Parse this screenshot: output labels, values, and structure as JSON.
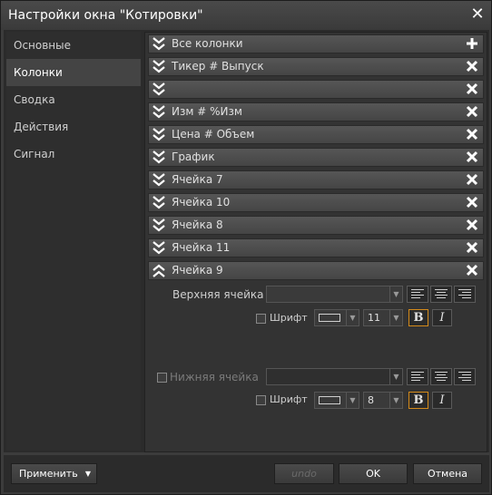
{
  "window": {
    "title": "Настройки окна \"Котировки\""
  },
  "sidebar": {
    "items": [
      {
        "label": "Основные"
      },
      {
        "label": "Колонки"
      },
      {
        "label": "Сводка"
      },
      {
        "label": "Действия"
      },
      {
        "label": "Сигнал"
      }
    ],
    "active_index": 1
  },
  "columns": {
    "rows": [
      {
        "label": "Все колонки",
        "action_icon": "plus-icon"
      },
      {
        "label": "Тикер # Выпуск",
        "action_icon": "close-icon"
      },
      {
        "label": "",
        "action_icon": "close-icon"
      },
      {
        "label": "Изм # %Изм",
        "action_icon": "close-icon"
      },
      {
        "label": "Цена # Объем",
        "action_icon": "close-icon"
      },
      {
        "label": "График",
        "action_icon": "close-icon"
      },
      {
        "label": "Ячейка 7",
        "action_icon": "close-icon"
      },
      {
        "label": "Ячейка 10",
        "action_icon": "close-icon"
      },
      {
        "label": "Ячейка 8",
        "action_icon": "close-icon"
      },
      {
        "label": "Ячейка 11",
        "action_icon": "close-icon"
      },
      {
        "label": "Ячейка 9",
        "action_icon": "close-icon",
        "expanded": true
      }
    ],
    "editor": {
      "top_cell": {
        "label": "Верхняя ячейка",
        "value": "",
        "font_checkbox_label": "Шрифт",
        "font_size": "11",
        "bold_label": "B",
        "italic_label": "I"
      },
      "bottom_cell": {
        "label": "Нижняя ячейка",
        "value": "",
        "font_checkbox_label": "Шрифт",
        "font_size": "8",
        "bold_label": "B",
        "italic_label": "I"
      }
    }
  },
  "footer": {
    "apply_label": "Применить",
    "undo_label": "undo",
    "ok_label": "OK",
    "cancel_label": "Отмена"
  },
  "colors": {
    "accent": "#d48a1a",
    "background": "#3c3c3c",
    "panel": "#2b2b2b"
  }
}
